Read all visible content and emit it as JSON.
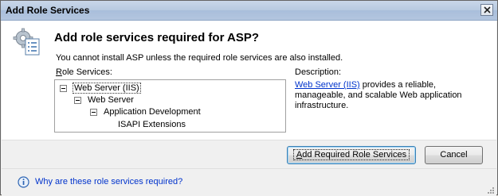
{
  "window": {
    "title": "Add Role Services"
  },
  "header": {
    "heading": "Add role services required for ASP?",
    "subtext": "You cannot install ASP unless the required role services are also installed."
  },
  "role_services": {
    "label_underlined": "R",
    "label_rest": "ole Services:",
    "tree": [
      {
        "label": "Web Server (IIS)",
        "level": 0,
        "expanded": true,
        "selected": true
      },
      {
        "label": "Web Server",
        "level": 1,
        "expanded": true
      },
      {
        "label": "Application Development",
        "level": 2,
        "expanded": true
      },
      {
        "label": "ISAPI Extensions",
        "level": 3
      }
    ]
  },
  "description": {
    "label": "Description:",
    "link": "Web Server (IIS)",
    "text": " provides a reliable, manageable, and scalable Web application infrastructure."
  },
  "buttons": {
    "add_underlined": "A",
    "add_rest": "dd Required Role Services",
    "cancel": "Cancel"
  },
  "help": {
    "link": "Why are these role services required?"
  },
  "colors": {
    "link": "#0033cc",
    "title_bar": "#b7c9e0"
  },
  "icons": {
    "header": "role-services-icon",
    "close": "close-icon",
    "help": "info-icon"
  }
}
